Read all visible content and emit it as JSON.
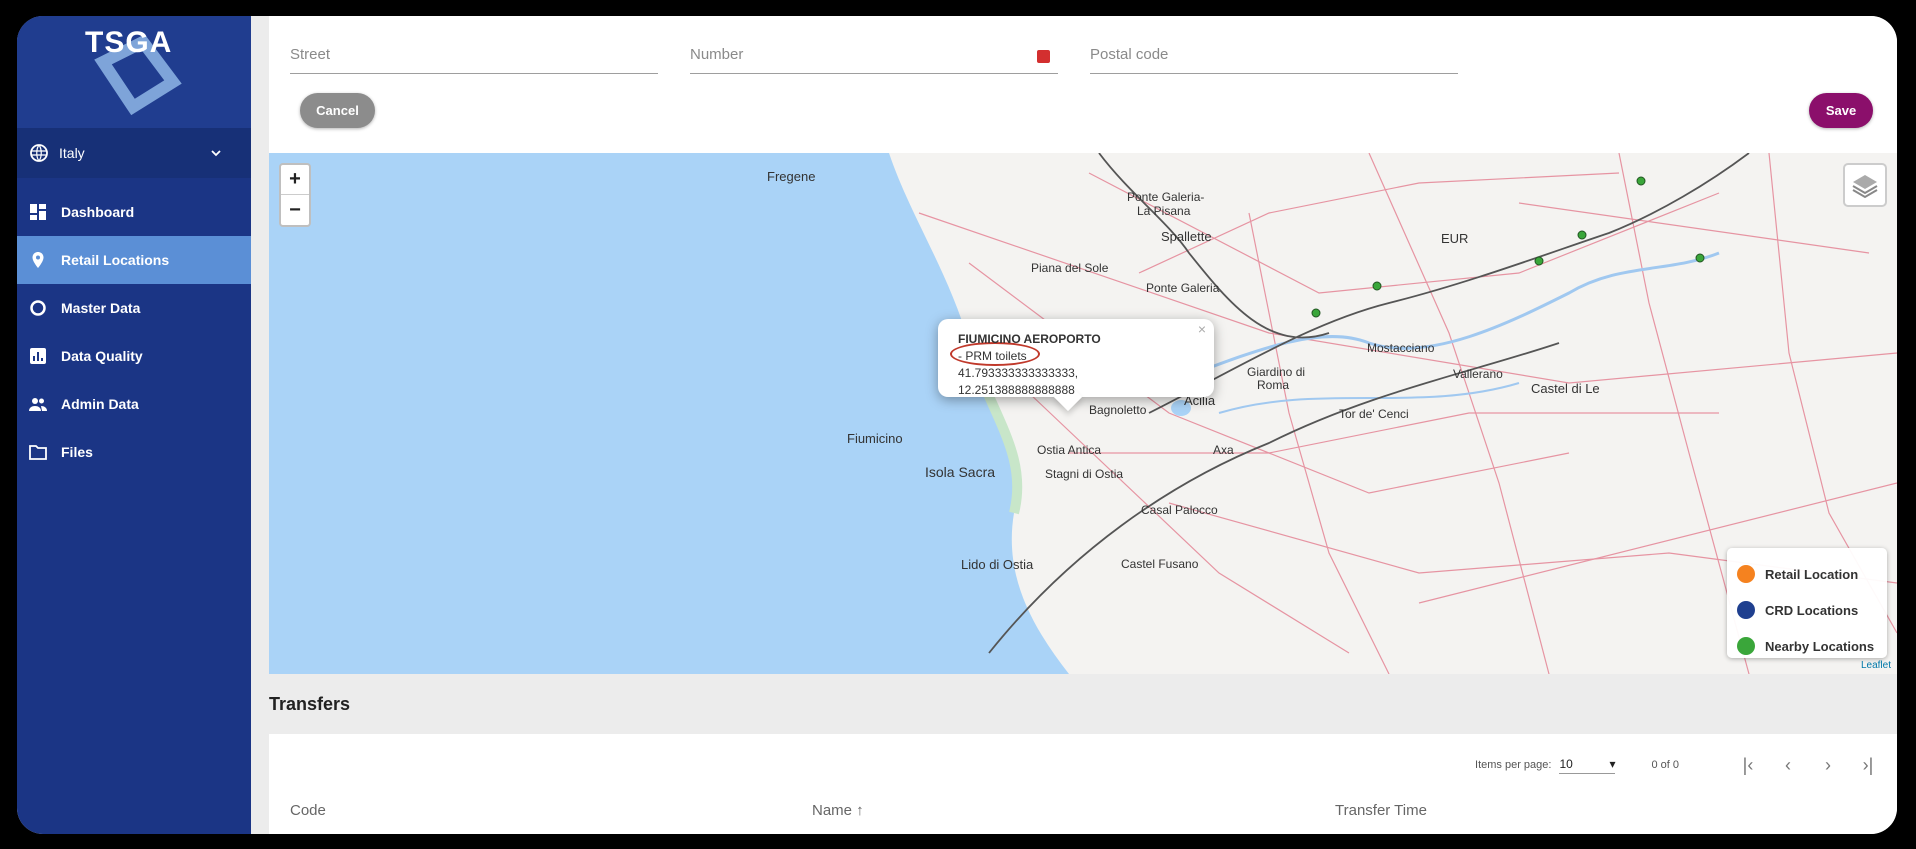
{
  "sidebar": {
    "logo_text": "TSGA",
    "country": "Italy",
    "items": [
      {
        "label": "Dashboard"
      },
      {
        "label": "Retail Locations"
      },
      {
        "label": "Master Data"
      },
      {
        "label": "Data Quality"
      },
      {
        "label": "Admin Data"
      },
      {
        "label": "Files"
      }
    ]
  },
  "form": {
    "street_placeholder": "Street",
    "number_placeholder": "Number",
    "postal_placeholder": "Postal code",
    "cancel_label": "Cancel",
    "save_label": "Save"
  },
  "map": {
    "places": [
      "Fregene",
      "Ponte Galeria-",
      "La Pisana",
      "Spallette",
      "Piana del Sole",
      "Ponte Galeria",
      "EUR",
      "Mostacciano",
      "Vallerano",
      "Castel di Le",
      "Giardino di",
      "Roma",
      "Acilia",
      "Bagnoletto",
      "Tor de' Cenci",
      "Fiumicino",
      "Ostia Antica",
      "Axa",
      "Isola Sacra",
      "Stagni di Ostia",
      "Casal Palocco",
      "Castel Fusano",
      "Lido di Ostia"
    ],
    "popup": {
      "title": "FIUMICINO AEROPORTO",
      "line": "- PRM toilets",
      "coords": "41.793333333333333, 12.251388888888888"
    },
    "zoom_in": "+",
    "zoom_out": "−",
    "legend": [
      {
        "label": "Retail Location",
        "color": "#f5821f"
      },
      {
        "label": "CRD Locations",
        "color": "#1f3f8f"
      },
      {
        "label": "Nearby Locations",
        "color": "#3aa63a"
      }
    ],
    "attribution": "Leaflet",
    "sea_color": "#aad3f7"
  },
  "transfers": {
    "title": "Transfers",
    "items_per_page_label": "Items per page:",
    "items_per_page": "10",
    "range": "0 of 0",
    "columns": [
      "Code",
      "Name ↑",
      "Transfer Time"
    ]
  }
}
